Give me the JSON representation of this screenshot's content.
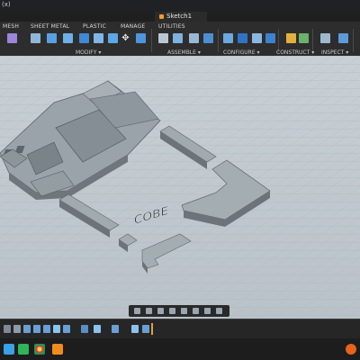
{
  "titlebar": {
    "left_text": "(x)"
  },
  "document": {
    "tab_title": "Sketch1"
  },
  "ribbon": {
    "tabs": [
      "MESH",
      "SHEET METAL",
      "PLASTIC",
      "MANAGE",
      "UTILITIES"
    ],
    "groups": [
      "MODIFY ▾",
      "ASSEMBLE ▾",
      "CONFIGURE ▾",
      "CONSTRUCT ▾",
      "INSPECT ▾"
    ]
  },
  "model": {
    "engraved_text": "COBE"
  },
  "colors": {
    "accent": "#f39a2b",
    "viewport": "#c3cbd0",
    "part": "#8f979d"
  }
}
